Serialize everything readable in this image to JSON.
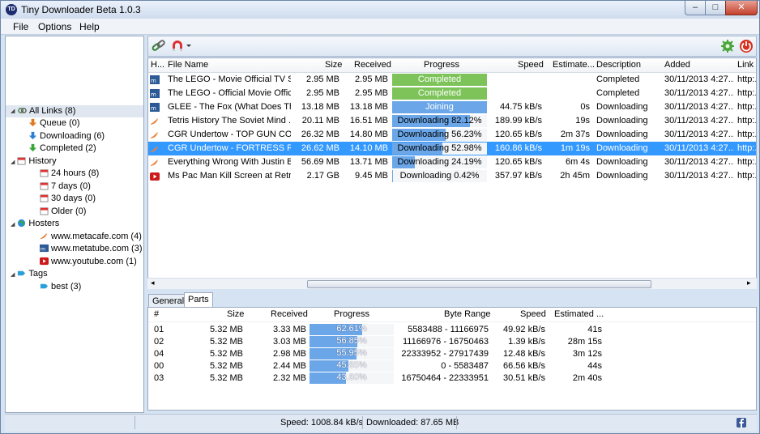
{
  "window": {
    "title": "Tiny Downloader Beta 1.0.3",
    "app_icon": "TD",
    "minimize_symbol": "–",
    "maximize_symbol": "□",
    "close_symbol": "✕"
  },
  "menu": [
    "File",
    "Options",
    "Help"
  ],
  "tree": {
    "all_links": "All Links (8)",
    "queue": "Queue (0)",
    "downloading": "Downloading (6)",
    "completed": "Completed (2)",
    "history": "History",
    "history_items": [
      "24 hours (8)",
      "7 days (0)",
      "30 days (0)",
      "Older (0)"
    ],
    "hosters": "Hosters",
    "hoster_items": [
      "www.metacafe.com (4)",
      "www.metatube.com (3)",
      "www.youtube.com (1)"
    ],
    "tags": "Tags",
    "tag_items": [
      "best (3)"
    ]
  },
  "grid": {
    "headers": [
      "H...",
      "File Name",
      "Size",
      "Received",
      "Progress",
      "Speed",
      "Estimate...",
      "Description",
      "Added",
      "Link"
    ],
    "rows": [
      {
        "host": "metatube",
        "name": "The LEGO - Movie Official TV S...",
        "size": "2.95 MB",
        "received": "2.95 MB",
        "progress_text": "Completed",
        "progress": 100,
        "status": "completed",
        "speed": "",
        "eta": "",
        "desc": "Completed",
        "added": "30/11/2013 4:27...",
        "link": "http:..."
      },
      {
        "host": "metatube",
        "name": "The LEGO - Official Movie Offic...",
        "size": "2.95 MB",
        "received": "2.95 MB",
        "progress_text": "Completed",
        "progress": 100,
        "status": "completed",
        "speed": "",
        "eta": "",
        "desc": "Completed",
        "added": "30/11/2013 4:27...",
        "link": "http:..."
      },
      {
        "host": "metatube",
        "name": "GLEE -  The Fox (What Does Th...",
        "size": "13.18 MB",
        "received": "13.18 MB",
        "progress_text": "Joining",
        "progress": 100,
        "status": "joining",
        "speed": "44.75 kB/s",
        "eta": "0s",
        "desc": "Downloading",
        "added": "30/11/2013 4:27...",
        "link": "http:..."
      },
      {
        "host": "metacafe",
        "name": "Tetris History The Soviet Mind ...",
        "size": "20.11 MB",
        "received": "16.51 MB",
        "progress_text": "Downloading 82.12%",
        "progress": 82.12,
        "status": "downloading",
        "speed": "189.99 kB/s",
        "eta": "19s",
        "desc": "Downloading",
        "added": "30/11/2013 4:27...",
        "link": "http:..."
      },
      {
        "host": "metacafe",
        "name": "CGR Undertow - TOP GUN CO...",
        "size": "26.32 MB",
        "received": "14.80 MB",
        "progress_text": "Downloading 56.23%",
        "progress": 56.23,
        "status": "downloading",
        "speed": "120.65 kB/s",
        "eta": "2m 37s",
        "desc": "Downloading",
        "added": "30/11/2013 4:27...",
        "link": "http:..."
      },
      {
        "host": "metacafe",
        "name": "CGR Undertow - FORTRESS Rev...",
        "size": "26.62 MB",
        "received": "14.10 MB",
        "progress_text": "Downloading 52.98%",
        "progress": 52.98,
        "status": "downloading",
        "speed": "160.86 kB/s",
        "eta": "1m 19s",
        "desc": "Downloading",
        "added": "30/11/2013 4:27...",
        "link": "http:...",
        "selected": true
      },
      {
        "host": "metacafe",
        "name": "Everything Wrong With Justin B...",
        "size": "56.69 MB",
        "received": "13.71 MB",
        "progress_text": "Downloading 24.19%",
        "progress": 24.19,
        "status": "downloading",
        "speed": "120.65 kB/s",
        "eta": "6m 4s",
        "desc": "Downloading",
        "added": "30/11/2013 4:27...",
        "link": "http:..."
      },
      {
        "host": "youtube",
        "name": "Ms Pac Man Kill Screen at Retro...",
        "size": "2.17 GB",
        "received": "9.45 MB",
        "progress_text": "Downloading 0.42%",
        "progress": 0.42,
        "status": "downloading",
        "speed": "357.97 kB/s",
        "eta": "2h 45m",
        "desc": "Downloading",
        "added": "30/11/2013 4:27...",
        "link": "http:..."
      }
    ]
  },
  "bottom_tabs": [
    "General",
    "Parts"
  ],
  "parts": {
    "headers": [
      "#",
      "Size",
      "Received",
      "Progress",
      "Byte Range",
      "Speed",
      "Estimated ..."
    ],
    "rows": [
      {
        "num": "01",
        "size": "5.32 MB",
        "received": "3.33 MB",
        "progress_text": "62.61%",
        "progress": 62.61,
        "range": "5583488 - 11166975",
        "speed": "49.92 kB/s",
        "eta": "41s"
      },
      {
        "num": "02",
        "size": "5.32 MB",
        "received": "3.03 MB",
        "progress_text": "56.85%",
        "progress": 56.85,
        "range": "11166976 - 16750463",
        "speed": "1.39 kB/s",
        "eta": "28m 15s"
      },
      {
        "num": "04",
        "size": "5.32 MB",
        "received": "2.98 MB",
        "progress_text": "55.95%",
        "progress": 55.95,
        "range": "22333952 - 27917439",
        "speed": "12.48 kB/s",
        "eta": "3m 12s"
      },
      {
        "num": "00",
        "size": "5.32 MB",
        "received": "2.44 MB",
        "progress_text": "45.85%",
        "progress": 45.85,
        "range": "0 - 5583487",
        "speed": "66.56 kB/s",
        "eta": "44s"
      },
      {
        "num": "03",
        "size": "5.32 MB",
        "received": "2.32 MB",
        "progress_text": "43.60%",
        "progress": 43.6,
        "range": "16750464 - 22333951",
        "speed": "30.51 kB/s",
        "eta": "2m 40s"
      }
    ]
  },
  "status": {
    "speed": "Speed: 1008.84 kB/s",
    "downloaded": "Downloaded: 87.65 MB"
  },
  "colors": {
    "selection": "#3399ff",
    "progress_fill": "#6aa6e8",
    "completed_fill": "#7dc35a",
    "metacafe": "#e8823a",
    "metatube": "#2b5a96",
    "youtube": "#cc1a1a"
  },
  "icons": {
    "links": "links-icon",
    "queue": "arrow-down-orange-icon",
    "downloading": "arrow-down-blue-icon",
    "completed": "arrow-down-green-icon",
    "history": "calendar-icon",
    "hosters": "globe-icon",
    "tags": "tag-icon",
    "add_link": "chain-link-icon",
    "magnet": "magnet-icon",
    "settings": "gear-icon",
    "power": "power-icon",
    "facebook": "facebook-icon"
  }
}
